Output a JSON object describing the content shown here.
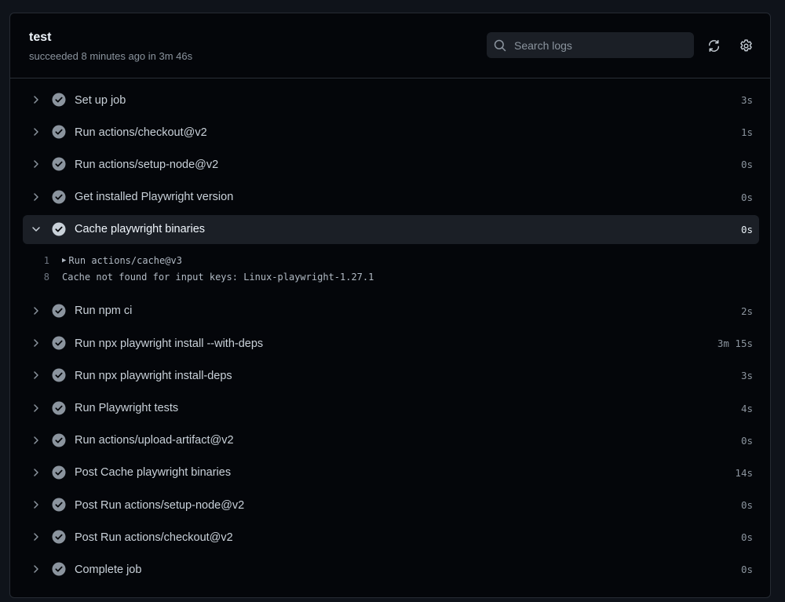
{
  "job": {
    "title": "test",
    "status": "succeeded 8 minutes ago in 3m 46s"
  },
  "search": {
    "placeholder": "Search logs",
    "value": ""
  },
  "toolbar": {
    "refresh_icon": "sync-icon",
    "settings_icon": "gear-icon"
  },
  "colors": {
    "success_check": "#8b949e",
    "background": "#04060a",
    "expanded_row": "#1b1f26"
  },
  "steps": [
    {
      "label": "Set up job",
      "time": "3s"
    },
    {
      "label": "Run actions/checkout@v2",
      "time": "1s"
    },
    {
      "label": "Run actions/setup-node@v2",
      "time": "0s"
    },
    {
      "label": "Get installed Playwright version",
      "time": "0s"
    },
    {
      "label": "Cache playwright binaries",
      "time": "0s",
      "expanded": true
    },
    {
      "label": "Run npm ci",
      "time": "2s"
    },
    {
      "label": "Run npx playwright install --with-deps",
      "time": "3m 15s"
    },
    {
      "label": "Run npx playwright install-deps",
      "time": "3s"
    },
    {
      "label": "Run Playwright tests",
      "time": "4s"
    },
    {
      "label": "Run actions/upload-artifact@v2",
      "time": "0s"
    },
    {
      "label": "Post Cache playwright binaries",
      "time": "14s"
    },
    {
      "label": "Post Run actions/setup-node@v2",
      "time": "0s"
    },
    {
      "label": "Post Run actions/checkout@v2",
      "time": "0s"
    },
    {
      "label": "Complete job",
      "time": "0s"
    }
  ],
  "log": [
    {
      "line": "1",
      "text": "Run actions/cache@v3",
      "collapsible": true
    },
    {
      "line": "8",
      "text": "Cache not found for input keys: Linux-playwright-1.27.1",
      "collapsible": false
    }
  ]
}
